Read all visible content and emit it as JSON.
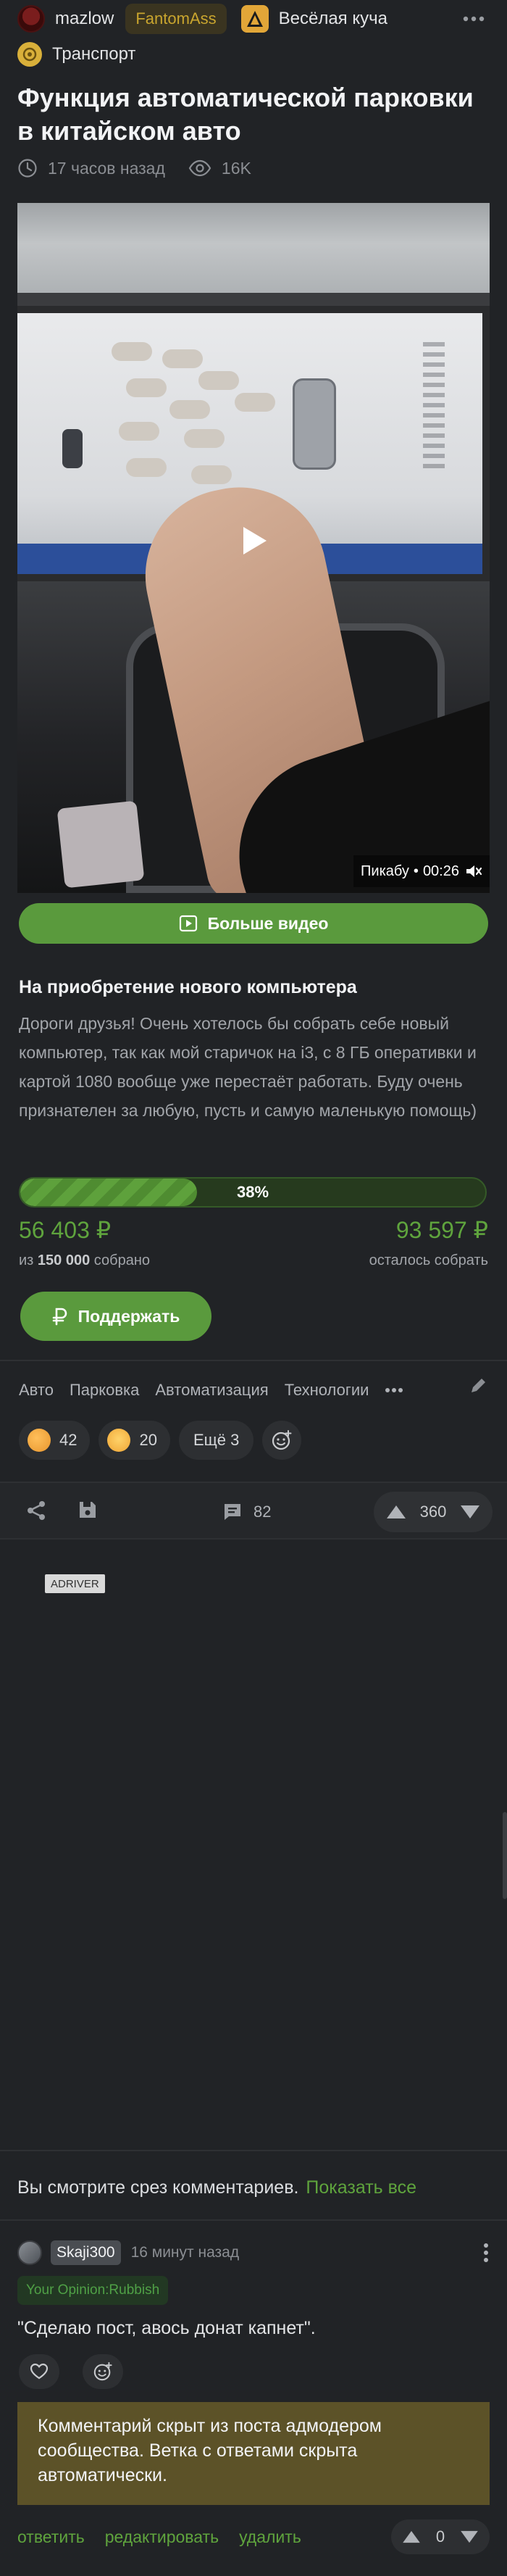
{
  "header": {
    "username": "mazlow",
    "badge": "FantomAss",
    "community": "Весёлая куча"
  },
  "post": {
    "category": "Транспорт",
    "title": "Функция автоматической парковки в китайском авто",
    "time": "17 часов назад",
    "views": "16K"
  },
  "video": {
    "source": "Пикабу",
    "separator": "•",
    "duration": "00:26",
    "more_label": "Больше видео"
  },
  "donation": {
    "title": "На приобретение нового компьютера",
    "text": "Дороги друзья! Очень хотелось бы собрать себе новый компьютер, так как мой старичок на i3, с 8 ГБ оперативки и картой 1080 вообще уже перестаёт работать. Буду очень признателен за любую, пусть и самую маленькую помощь)",
    "progress_percent": 38,
    "progress_label": "38%",
    "collected": "56 403 ₽",
    "collected_prefix": "из",
    "goal": "150 000",
    "collected_suffix": "собрано",
    "remaining": "93 597 ₽",
    "remaining_label": "осталось собрать",
    "support_label": "Поддержать"
  },
  "tags": [
    "Авто",
    "Парковка",
    "Автоматизация",
    "Технологии"
  ],
  "reactions": {
    "items": [
      {
        "emoji": "clap-emoji-icon",
        "count": "42",
        "color": "#e8962e"
      },
      {
        "emoji": "scared-emoji-icon",
        "count": "20",
        "color": "#f0a535"
      }
    ],
    "more_label": "Ещё 3"
  },
  "actions": {
    "comments_count": "82",
    "rating": "360"
  },
  "ad": {
    "label": "ADRIVER"
  },
  "comments_slice": {
    "text": "Вы смотрите срез комментариев.",
    "show_all": "Показать все"
  },
  "comment": {
    "user": "Skaji300",
    "time": "16 минут назад",
    "opinion": "Your Opinion:Rubbish",
    "text": "\"Сделаю пост, авось донат капнет\".",
    "hidden_notice": "Комментарий скрыт из поста адмодером сообщества. Ветка с ответами скрыта автоматически.",
    "reply": "ответить",
    "edit": "редактировать",
    "delete": "удалить",
    "rating": "0"
  },
  "colors": {
    "background": "#212326",
    "accent_green": "#5a9a3d",
    "money_green": "#5fa43d",
    "hidden_notice_bg": "#5c5228"
  }
}
